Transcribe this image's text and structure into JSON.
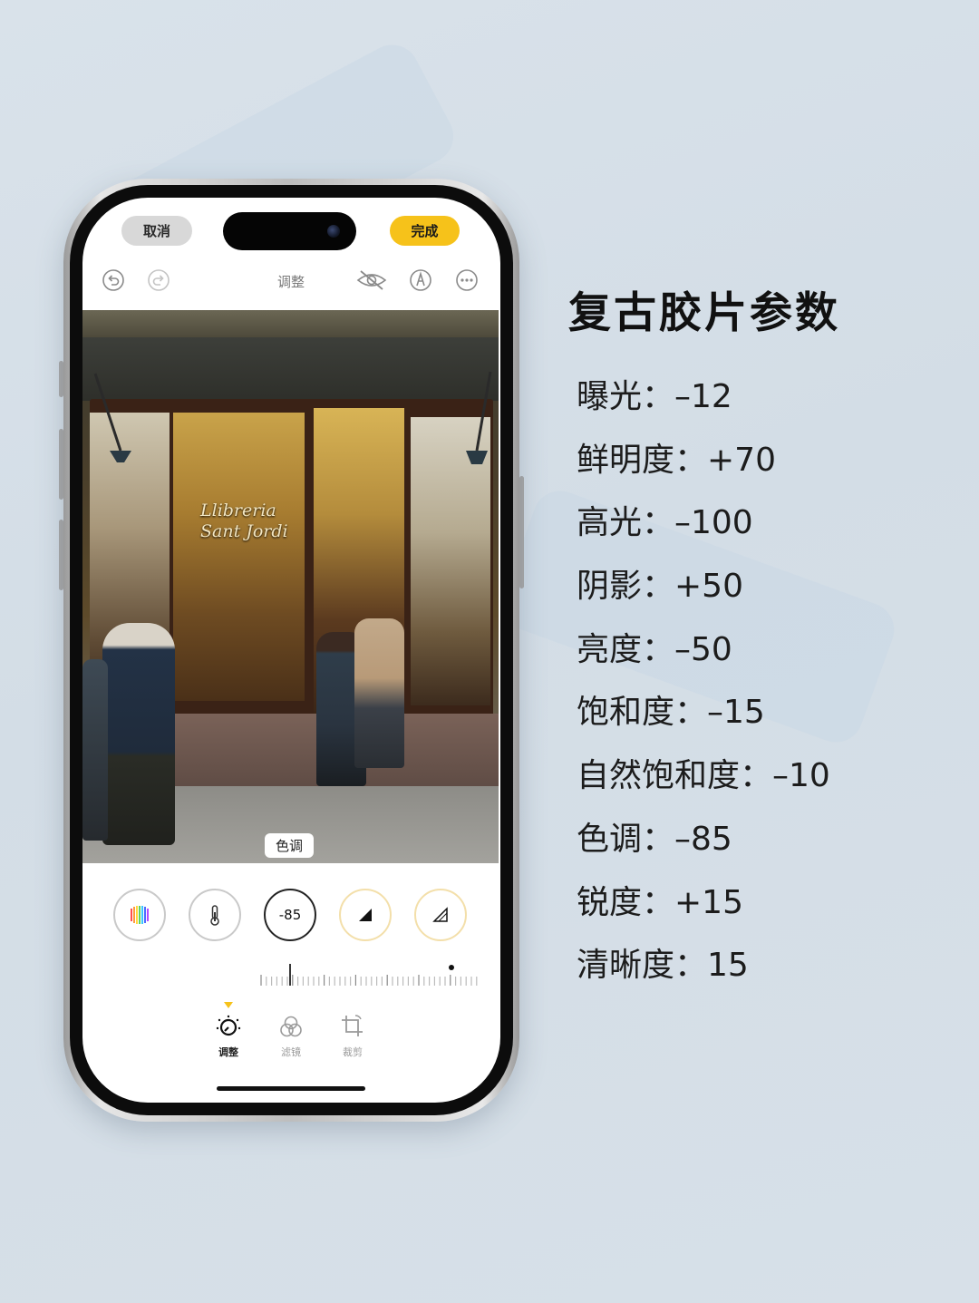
{
  "top_bar": {
    "cancel_label": "取消",
    "done_label": "完成",
    "title": "调整"
  },
  "photo": {
    "sign_line1": "Llibreria",
    "sign_line2": "Sant Jordi",
    "tone_label": "色调"
  },
  "adjust": {
    "dials": [
      {
        "name": "auto",
        "icon": "rainbow-auto-icon"
      },
      {
        "name": "warmth",
        "icon": "thermometer-icon"
      },
      {
        "name": "tint",
        "value": "-85",
        "selected": true
      },
      {
        "name": "sharpness",
        "icon": "triangle-filled-icon"
      },
      {
        "name": "definition",
        "icon": "triangle-outline-icon"
      }
    ]
  },
  "tabs": [
    {
      "label": "调整",
      "icon": "adjust-dial-icon",
      "active": true
    },
    {
      "label": "滤镜",
      "icon": "filters-icon",
      "active": false
    },
    {
      "label": "裁剪",
      "icon": "crop-icon",
      "active": false
    }
  ],
  "panel": {
    "heading": "复古胶片参数",
    "params": [
      "曝光：–12",
      "鲜明度：+70",
      "高光：–100",
      "阴影：+50",
      "亮度：–50",
      "饱和度：–15",
      "自然饱和度：–10",
      "色调：–85",
      "锐度：+15",
      "清晰度：15"
    ]
  },
  "colors": {
    "done_button": "#f6c21a",
    "accent_amber": "#f3dfaa",
    "background": "#d7e0e8"
  }
}
